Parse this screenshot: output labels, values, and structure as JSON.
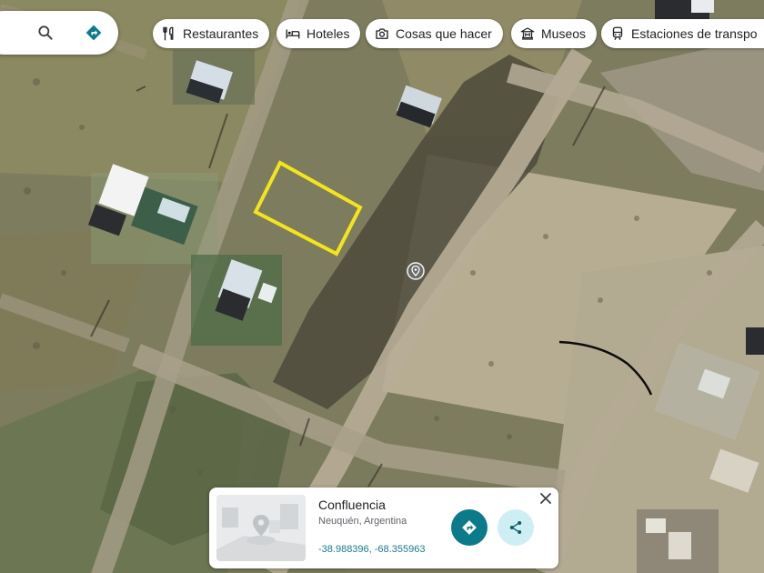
{
  "chips": [
    {
      "label": "Restaurantes",
      "icon": "fork-knife-icon"
    },
    {
      "label": "Hoteles",
      "icon": "bed-icon"
    },
    {
      "label": "Cosas que hacer",
      "icon": "camera-icon"
    },
    {
      "label": "Museos",
      "icon": "museum-icon"
    },
    {
      "label": "Estaciones de transpo",
      "icon": "train-icon"
    }
  ],
  "place_card": {
    "title": "Confluencia",
    "subtitle": "Neuquén, Argentina",
    "coordinates": "-38.988396, -68.355963"
  },
  "colors": {
    "accent": "#0b7a8a",
    "highlight": "#f4e51b",
    "coords_text": "#1a7a8a"
  }
}
